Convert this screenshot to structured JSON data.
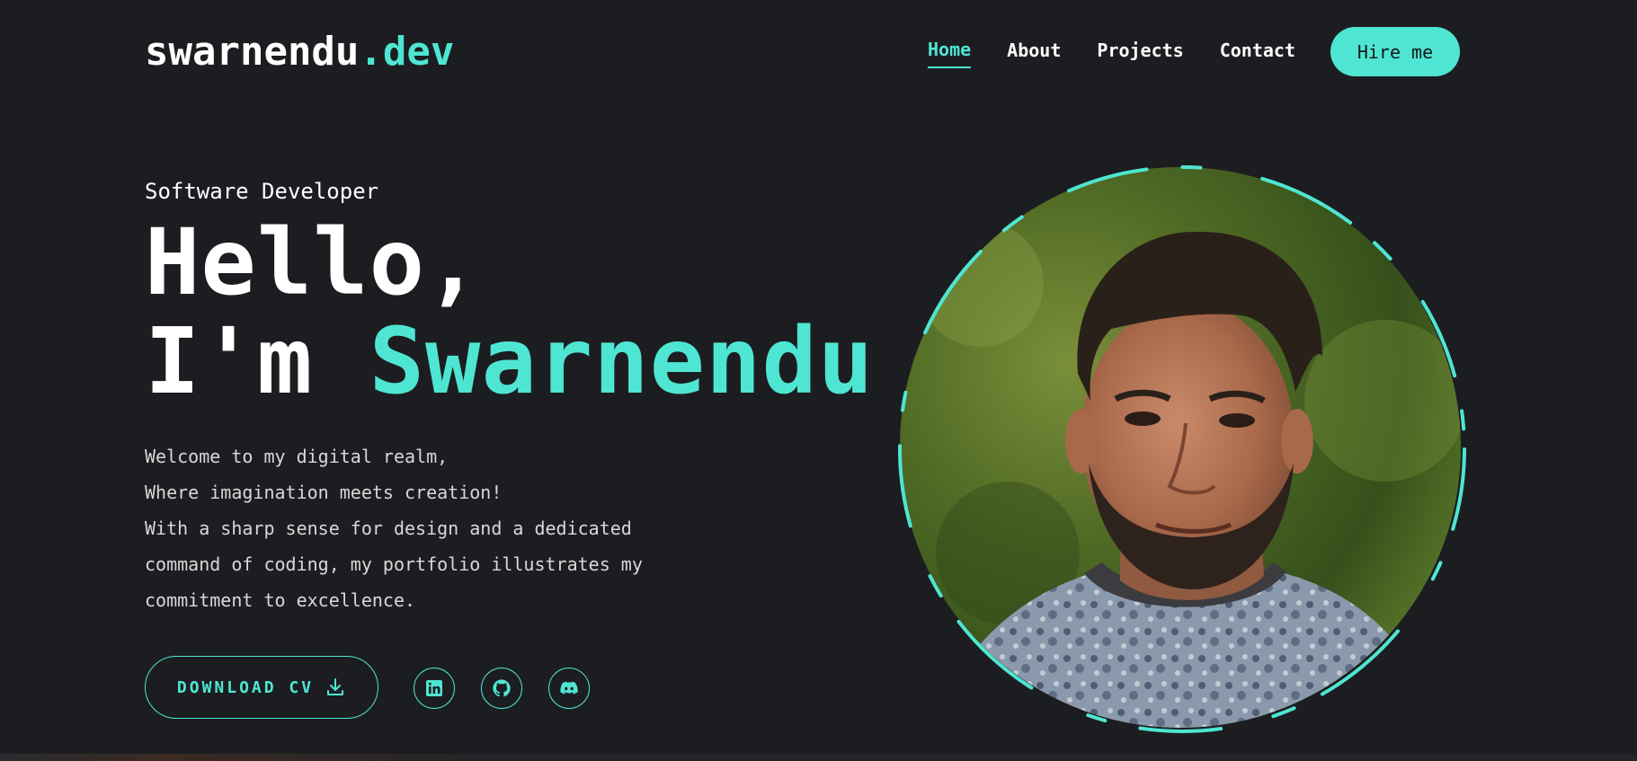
{
  "logo": {
    "main": "swarnendu",
    "accent": ".dev"
  },
  "nav": {
    "items": [
      {
        "label": "Home",
        "active": true
      },
      {
        "label": "About",
        "active": false
      },
      {
        "label": "Projects",
        "active": false
      },
      {
        "label": "Contact",
        "active": false
      }
    ],
    "hire_label": "Hire me"
  },
  "hero": {
    "subtitle": "Software Developer",
    "line1": "Hello,",
    "line2_prefix": "I'm ",
    "name": "Swarnendu",
    "intro": [
      "Welcome to my digital realm,",
      "Where imagination meets creation!",
      "With a sharp sense for design and a dedicated",
      "command of coding, my portfolio illustrates my",
      "commitment to excellence."
    ]
  },
  "actions": {
    "download_label": "DOWNLOAD CV",
    "download_icon": "download-icon",
    "socials": [
      {
        "name": "linkedin-icon"
      },
      {
        "name": "github-icon"
      },
      {
        "name": "discord-icon"
      }
    ]
  },
  "colors": {
    "accent": "#4ee6d2",
    "background": "#1c1d21",
    "text": "#ffffff"
  }
}
